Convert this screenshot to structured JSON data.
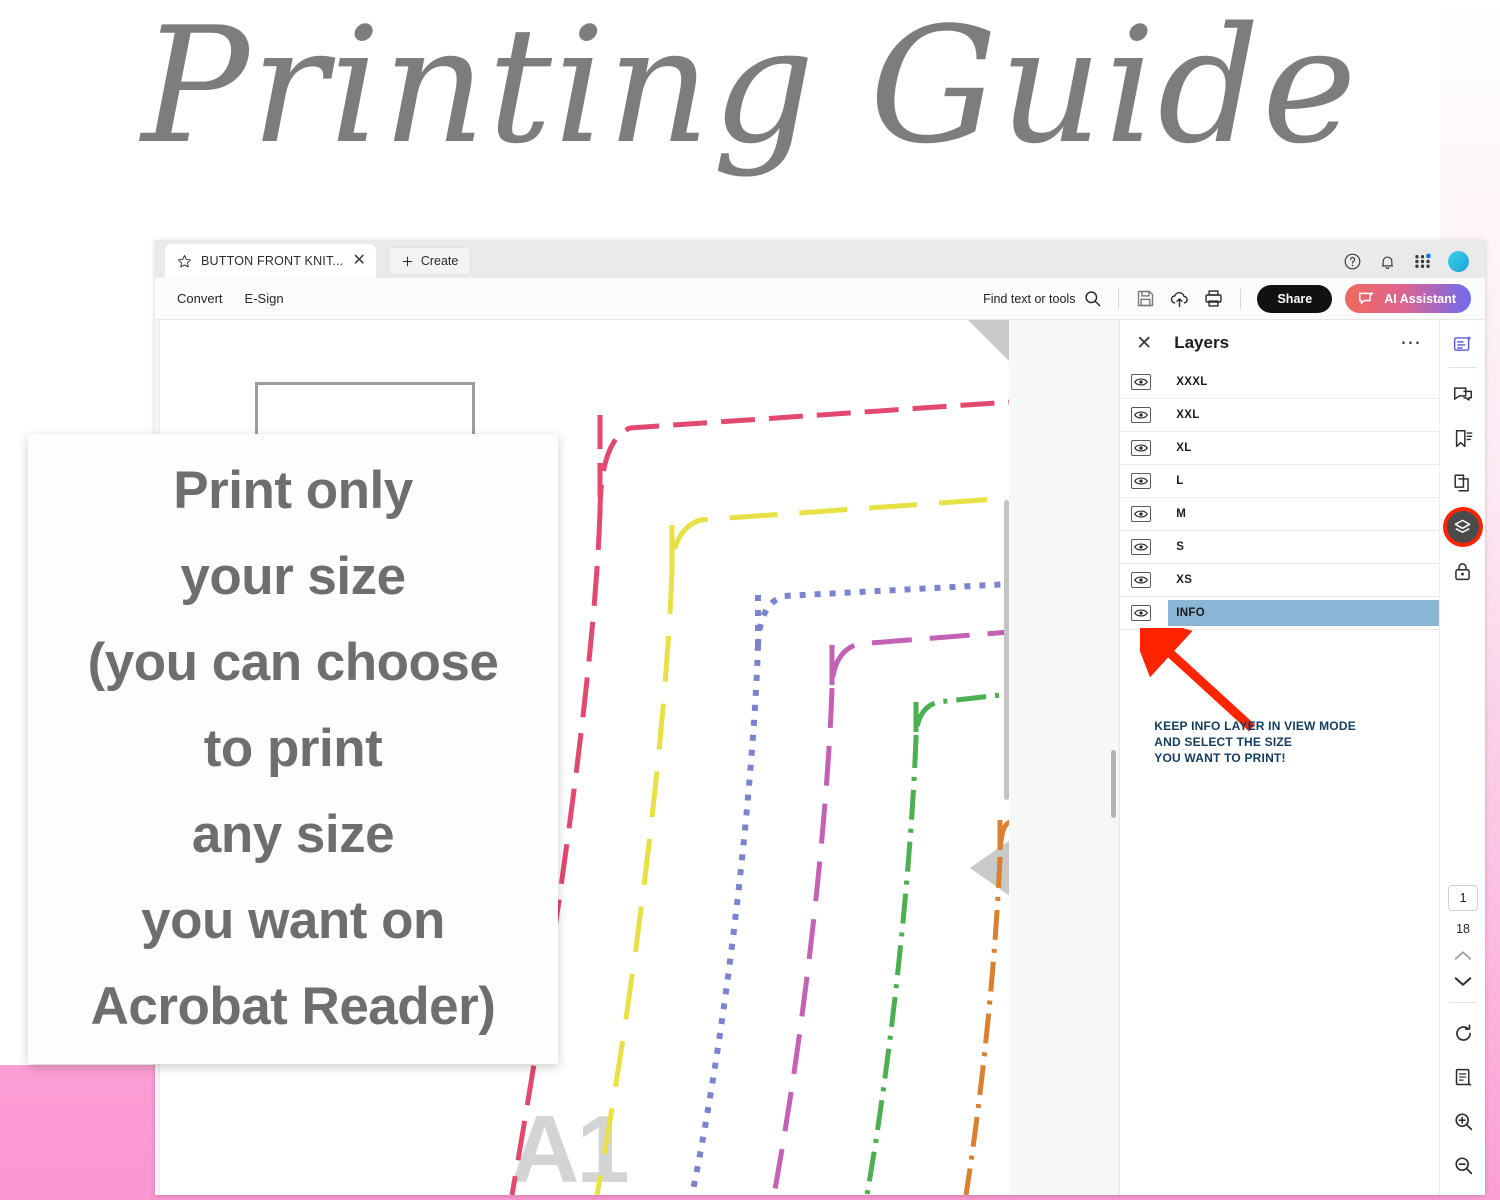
{
  "page": {
    "title": "Printing Guide",
    "background_pink": "#fb9ed3"
  },
  "overlay": {
    "lines": [
      "Print only",
      "your size",
      "(you can choose",
      "to print",
      "any size",
      "you want on",
      "Acrobat Reader)"
    ],
    "text_color": "#6e6e6e"
  },
  "app": {
    "tab": {
      "title": "BUTTON FRONT KNIT...",
      "star_icon": "star-icon",
      "close_icon": "close-icon"
    },
    "create_button": "Create",
    "window_icons": [
      "help-circle-icon",
      "bell-icon",
      "apps-grid-icon",
      "avatar"
    ],
    "toolbar": {
      "menus": [
        "Convert",
        "E-Sign"
      ],
      "find_placeholder": "Find text or tools",
      "icons": [
        "search-icon",
        "save-icon",
        "cloud-upload-icon",
        "print-icon"
      ],
      "share_label": "Share",
      "ai_label": "AI Assistant",
      "ai_gradient_from": "#ef6a5d",
      "ai_gradient_to": "#6f6bf0"
    }
  },
  "document": {
    "watermark": "A1"
  },
  "layers_panel": {
    "title": "Layers",
    "close_icon": "close-icon",
    "more_icon": "overflow-menu-icon",
    "items": [
      {
        "name": "XXXL",
        "visible": true,
        "selected": false
      },
      {
        "name": "XXL",
        "visible": true,
        "selected": false
      },
      {
        "name": "XL",
        "visible": true,
        "selected": false
      },
      {
        "name": "L",
        "visible": true,
        "selected": false
      },
      {
        "name": "M",
        "visible": true,
        "selected": false
      },
      {
        "name": "S",
        "visible": true,
        "selected": false
      },
      {
        "name": "XS",
        "visible": true,
        "selected": false
      },
      {
        "name": "INFO",
        "visible": true,
        "selected": true
      }
    ],
    "selected_highlight": "#8ab5d4"
  },
  "annotation": {
    "text": "KEEP INFO LAYER IN VIEW MODE\nAND SELECT THE SIZE\nYOU WANT TO PRINT!",
    "text_color": "#123c5e",
    "arrow_color": "#ff2400"
  },
  "right_rail": {
    "icons": [
      "ai-document-icon",
      "comment-icon",
      "bookmark-icon",
      "pages-copy-icon",
      "layers-icon",
      "lock-icon"
    ],
    "active_icon": "layers-icon",
    "active_ring_color": "#ff2400"
  },
  "page_nav": {
    "current_page": "1",
    "total_pages": "18",
    "up_icon": "chevron-up-icon",
    "down_icon": "chevron-down-icon",
    "tools": [
      "rotate-icon",
      "fit-page-icon",
      "zoom-in-icon",
      "zoom-out-icon"
    ]
  },
  "pattern_colors": {
    "xxxl": "#e2496f",
    "xxl": "#e8e145",
    "xl": "#7b83cf",
    "l": "#c361b5",
    "m": "#4caf50",
    "s": "#d98031"
  }
}
